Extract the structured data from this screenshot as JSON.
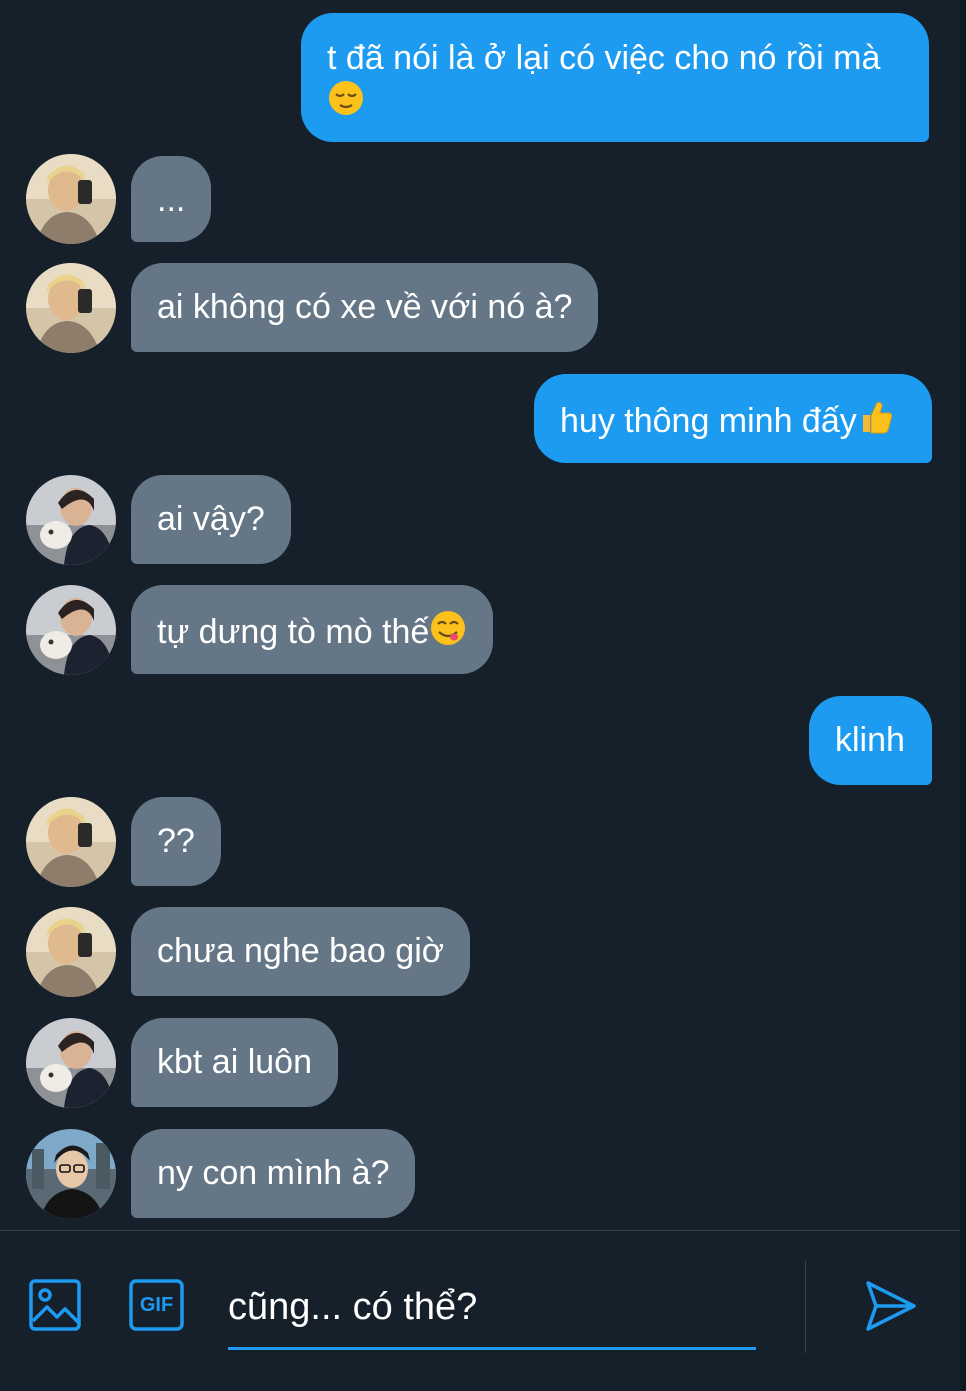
{
  "messages": [
    {
      "side": "out",
      "text": "t đã nói là ở lại có việc cho nó rồi mà",
      "emoji": "relieved-face"
    },
    {
      "side": "in",
      "avatar": "blonde-selfie",
      "text": "..."
    },
    {
      "side": "in",
      "avatar": "blonde-selfie",
      "text": "ai không có xe về với nó à?"
    },
    {
      "side": "out",
      "text": "huy thông minh đấy",
      "emoji": "thumbs-up"
    },
    {
      "side": "in",
      "avatar": "dark-hair-dog",
      "text": "ai vậy?"
    },
    {
      "side": "in",
      "avatar": "dark-hair-dog",
      "text": "tự dưng tò mò thế",
      "emoji": "yum-face"
    },
    {
      "side": "out",
      "text": "klinh"
    },
    {
      "side": "in",
      "avatar": "blonde-selfie",
      "text": "??"
    },
    {
      "side": "in",
      "avatar": "blonde-selfie",
      "text": "chưa nghe bao giờ"
    },
    {
      "side": "in",
      "avatar": "dark-hair-dog",
      "text": "kbt ai luôn"
    },
    {
      "side": "in",
      "avatar": "glasses-street",
      "text": "ny con mình à?"
    }
  ],
  "composer": {
    "text": "cũng... có thể?",
    "image_icon": "image-icon",
    "gif_label": "GIF",
    "send_icon": "send-icon"
  },
  "colors": {
    "background": "#15202b",
    "outgoing_bubble": "#1d9bf0",
    "incoming_bubble": "#657786",
    "accent": "#1d9bf0"
  }
}
